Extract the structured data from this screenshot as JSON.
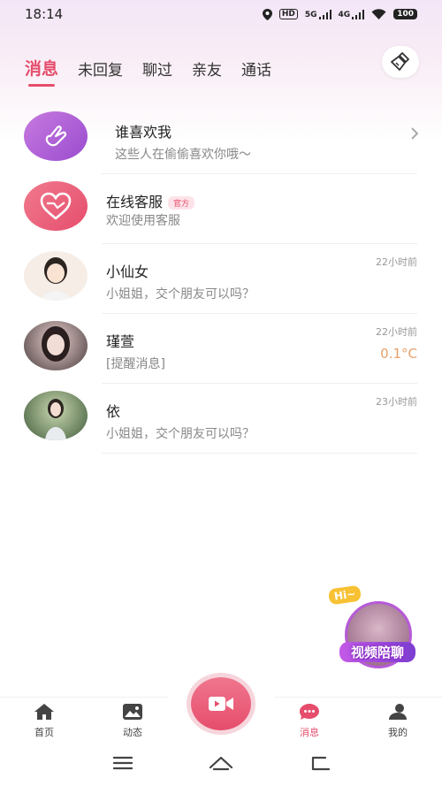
{
  "status_bar": {
    "time": "18:14",
    "hd_label": "HD",
    "sig5g_label": "5G",
    "sig4g_label": "4G",
    "battery": "100"
  },
  "tabs": [
    {
      "label": "消息",
      "active": true
    },
    {
      "label": "未回复",
      "active": false
    },
    {
      "label": "聊过",
      "active": false
    },
    {
      "label": "亲友",
      "active": false
    },
    {
      "label": "通话",
      "active": false
    }
  ],
  "colors": {
    "accent": "#e64d6c",
    "time_gray": "#999999",
    "temp_orange": "#e8a06a"
  },
  "messages": [
    {
      "name": "谁喜欢我",
      "preview": "这些人在偷偷喜欢你哦～",
      "icon": "finger-heart-icon"
    },
    {
      "name": "在线客服",
      "badge": "官方",
      "preview": "欢迎使用客服",
      "icon": "heart-icon"
    },
    {
      "name": "小仙女",
      "preview": "小姐姐，交个朋友可以吗？",
      "time": "22小时前"
    },
    {
      "name": "瑾萱",
      "preview": "[提醒消息]",
      "time": "22小时前",
      "extra": "0.1°C"
    },
    {
      "name": "依",
      "preview": "小姐姐，交个朋友可以吗？",
      "time": "23小时前"
    }
  ],
  "floating": {
    "hi": "Hi~",
    "label": "视频陪聊"
  },
  "bottom_nav": [
    {
      "label": "首页",
      "icon": "home-icon"
    },
    {
      "label": "动态",
      "icon": "image-icon"
    },
    {
      "label": "消息",
      "icon": "chat-bubble-icon",
      "active": true
    },
    {
      "label": "我的",
      "icon": "profile-icon"
    }
  ]
}
